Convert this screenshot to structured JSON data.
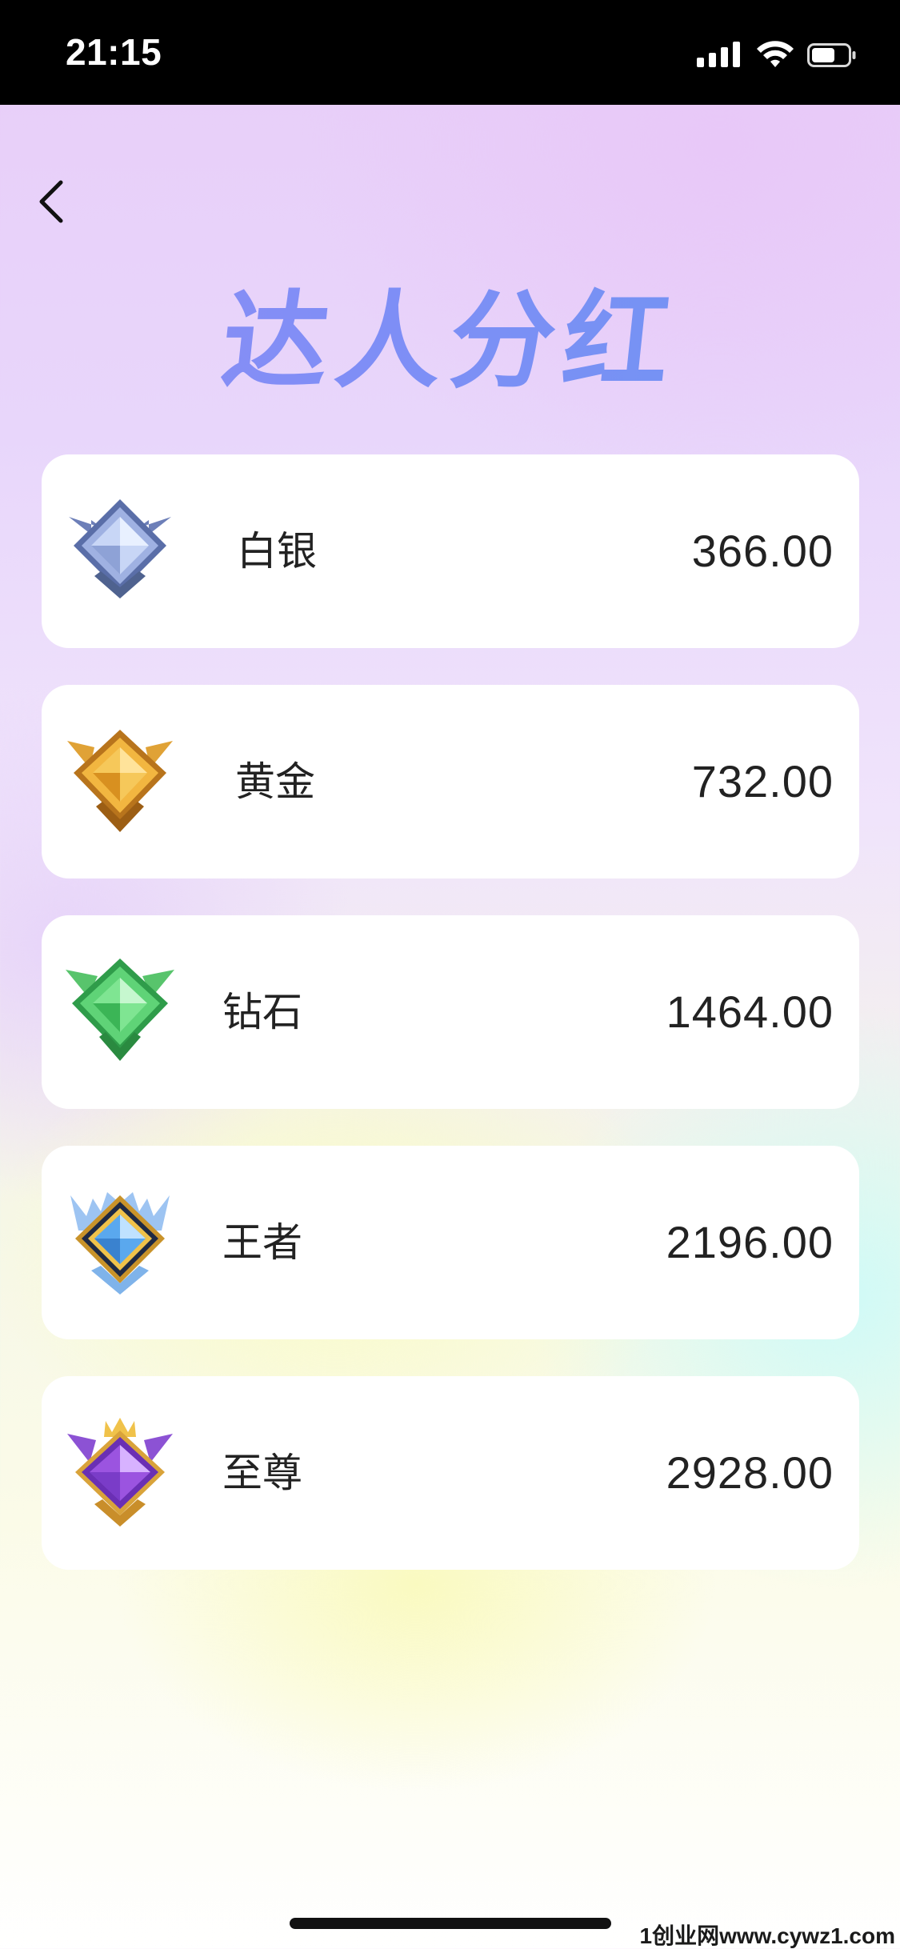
{
  "status_bar": {
    "time": "21:15",
    "signal_icon": "cellular-signal-icon",
    "wifi_icon": "wifi-icon",
    "battery_icon": "battery-icon"
  },
  "header": {
    "back_icon": "chevron-left-icon",
    "title": "达人分红"
  },
  "tiers": [
    {
      "name": "白银",
      "amount": "366.00",
      "badge_icon": "silver-badge-icon",
      "color": "#7b8fc6"
    },
    {
      "name": "黄金",
      "amount": "732.00",
      "badge_icon": "gold-badge-icon",
      "color": "#e0a236"
    },
    {
      "name": "钻石",
      "amount": "1464.00",
      "badge_icon": "diamond-badge-icon",
      "color": "#4fc768"
    },
    {
      "name": "王者",
      "amount": "2196.00",
      "badge_icon": "king-badge-icon",
      "color": "#5aa8ee"
    },
    {
      "name": "至尊",
      "amount": "2928.00",
      "badge_icon": "supreme-badge-icon",
      "color": "#9b54e0"
    }
  ],
  "watermark": "1创业网www.cywz1.com"
}
